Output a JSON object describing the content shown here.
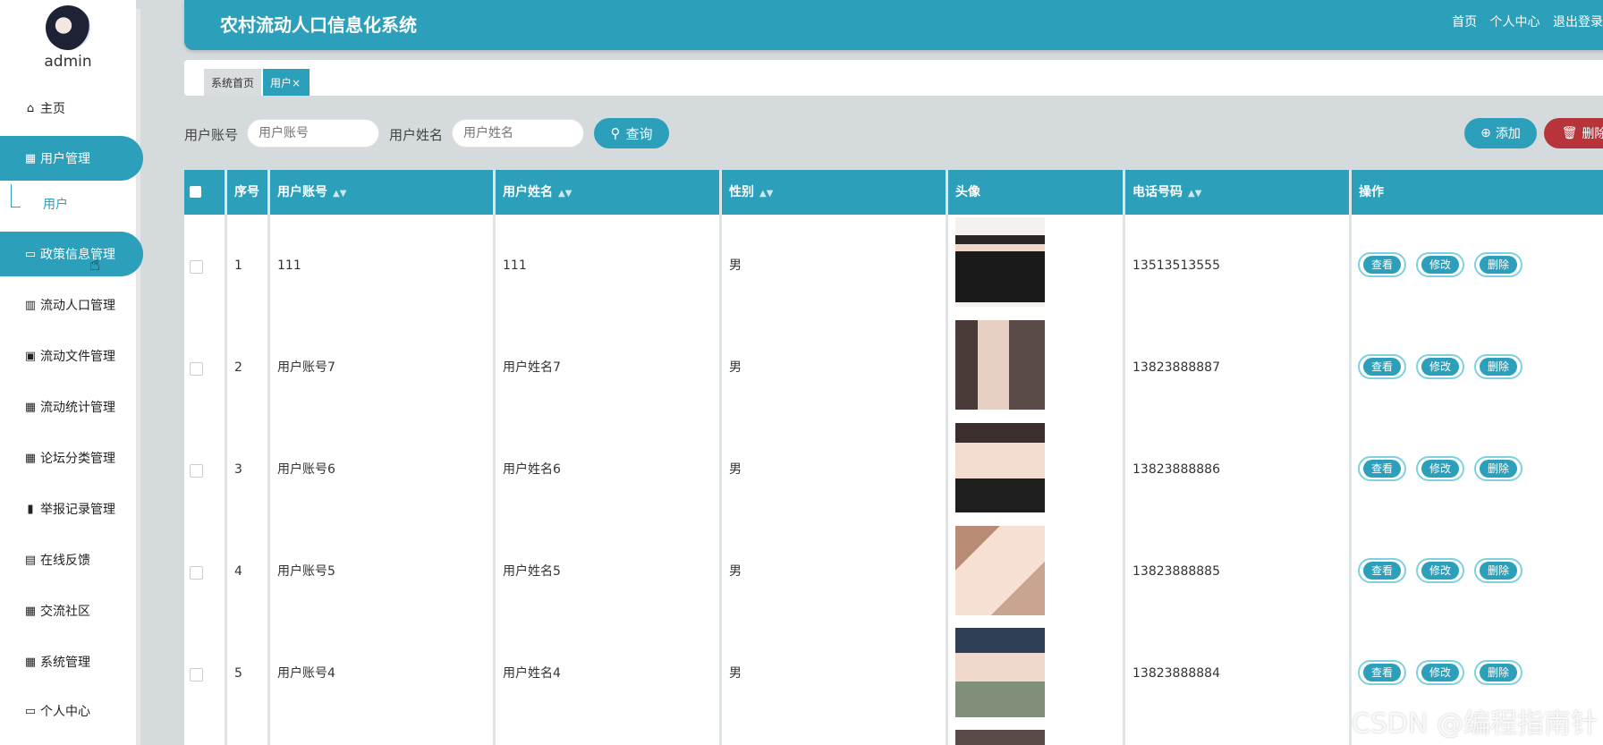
{
  "app": {
    "title": "农村流动人口信息化系统"
  },
  "user": {
    "name": "admin"
  },
  "header_links": [
    "首页",
    "个人中心",
    "退出登录"
  ],
  "sidebar": {
    "items": [
      {
        "label": "主页",
        "icon": "home-icon"
      },
      {
        "label": "用户管理",
        "icon": "grid-icon",
        "active": true
      },
      {
        "label": "政策信息管理",
        "icon": "monitor-icon",
        "active": true
      },
      {
        "label": "流动人口管理",
        "icon": "library-icon"
      },
      {
        "label": "流动文件管理",
        "icon": "briefcase-icon"
      },
      {
        "label": "流动统计管理",
        "icon": "grid-icon"
      },
      {
        "label": "论坛分类管理",
        "icon": "grid-icon"
      },
      {
        "label": "举报记录管理",
        "icon": "bar-chart-icon"
      },
      {
        "label": "在线反馈",
        "icon": "clipboard-icon"
      },
      {
        "label": "交流社区",
        "icon": "grid-icon"
      },
      {
        "label": "系统管理",
        "icon": "grid-icon"
      },
      {
        "label": "个人中心",
        "icon": "card-icon"
      }
    ],
    "sub_item": "用户"
  },
  "tabs": [
    {
      "label": "系统首页"
    },
    {
      "label": "用户×",
      "active": true
    }
  ],
  "search": {
    "account_label": "用户账号",
    "account_placeholder": "用户账号",
    "name_label": "用户姓名",
    "name_placeholder": "用户姓名",
    "query_label": "查询"
  },
  "toolbar": {
    "add_label": "添加",
    "delete_label": "删除"
  },
  "table": {
    "headers": [
      "序号",
      "用户账号",
      "用户姓名",
      "性别",
      "头像",
      "电话号码",
      "操作"
    ],
    "rows": [
      {
        "index": "1",
        "account": "111",
        "name": "111",
        "gender": "男",
        "phone": "13513513555"
      },
      {
        "index": "2",
        "account": "用户账号7",
        "name": "用户姓名7",
        "gender": "男",
        "phone": "13823888887"
      },
      {
        "index": "3",
        "account": "用户账号6",
        "name": "用户姓名6",
        "gender": "男",
        "phone": "13823888886"
      },
      {
        "index": "4",
        "account": "用户账号5",
        "name": "用户姓名5",
        "gender": "男",
        "phone": "13823888885"
      },
      {
        "index": "5",
        "account": "用户账号4",
        "name": "用户姓名4",
        "gender": "男",
        "phone": "13823888884"
      }
    ],
    "actions": {
      "view": "查看",
      "edit": "修改",
      "delete": "删除"
    }
  },
  "watermark": "CSDN @编程指南针",
  "colors": {
    "primary": "#2c9fba",
    "danger": "#b8343b"
  }
}
